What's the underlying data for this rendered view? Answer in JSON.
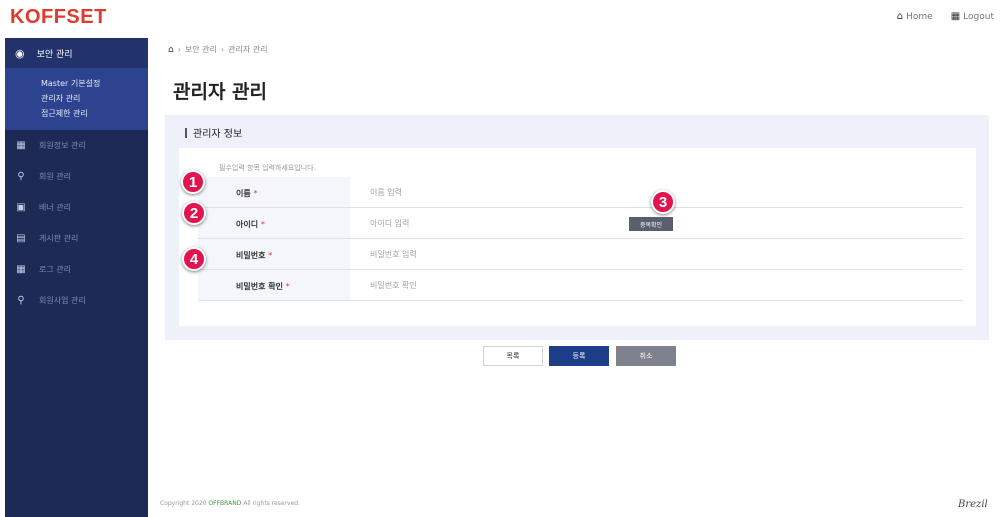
{
  "app": {
    "logo": "KOFFSET"
  },
  "top_links": [
    {
      "icon": "home-icon",
      "label": "Home"
    },
    {
      "icon": "user-icon",
      "label": "Logout"
    }
  ],
  "sidebar": {
    "active": {
      "icon": "shield-icon",
      "label": "보안 관리"
    },
    "sub_items": [
      "Master 기본설정",
      "관리자 관리",
      "접근제한 관리"
    ],
    "items": [
      {
        "icon": "grid-icon",
        "label": "회원정보 관리"
      },
      {
        "icon": "person-icon",
        "label": "회원 관리"
      },
      {
        "icon": "monitor-icon",
        "label": "배너 관리"
      },
      {
        "icon": "board-icon",
        "label": "게시판 관리"
      },
      {
        "icon": "grid-icon",
        "label": "로그 관리"
      },
      {
        "icon": "person-icon",
        "label": "회원사업 관리"
      }
    ]
  },
  "breadcrumb": [
    "보안 관리",
    "관리자 관리"
  ],
  "page_title": "관리자 관리",
  "panel": {
    "title": "관리자 정보",
    "required_note": "필수입력 항목 입력하세요입니다.",
    "fields": [
      {
        "label": "이름",
        "required": "*",
        "placeholder": "이름 입력"
      },
      {
        "label": "아이디",
        "required": "*",
        "placeholder": "아이디 입력",
        "button": "중복확인"
      },
      {
        "label": "비밀번호",
        "required": "*",
        "placeholder": "비밀번호 입력"
      },
      {
        "label": "비밀번호 확인",
        "required": "*",
        "placeholder": "비밀번호 확인"
      }
    ]
  },
  "callouts": [
    "1",
    "2",
    "3",
    "4"
  ],
  "buttons": {
    "list": "목록",
    "submit": "등록",
    "cancel": "취소"
  },
  "footer": {
    "prefix": "Copyright 2020",
    "company": "OFFBRAND",
    "suffix": "All rights reserved.",
    "logo": "Brezil"
  },
  "colors": {
    "sidebar": "#1c2a55",
    "sidebar_active": "#2d4390",
    "accent": "#e03a2f",
    "primary_button": "#1d3f8a",
    "callout": "#e1144f"
  }
}
